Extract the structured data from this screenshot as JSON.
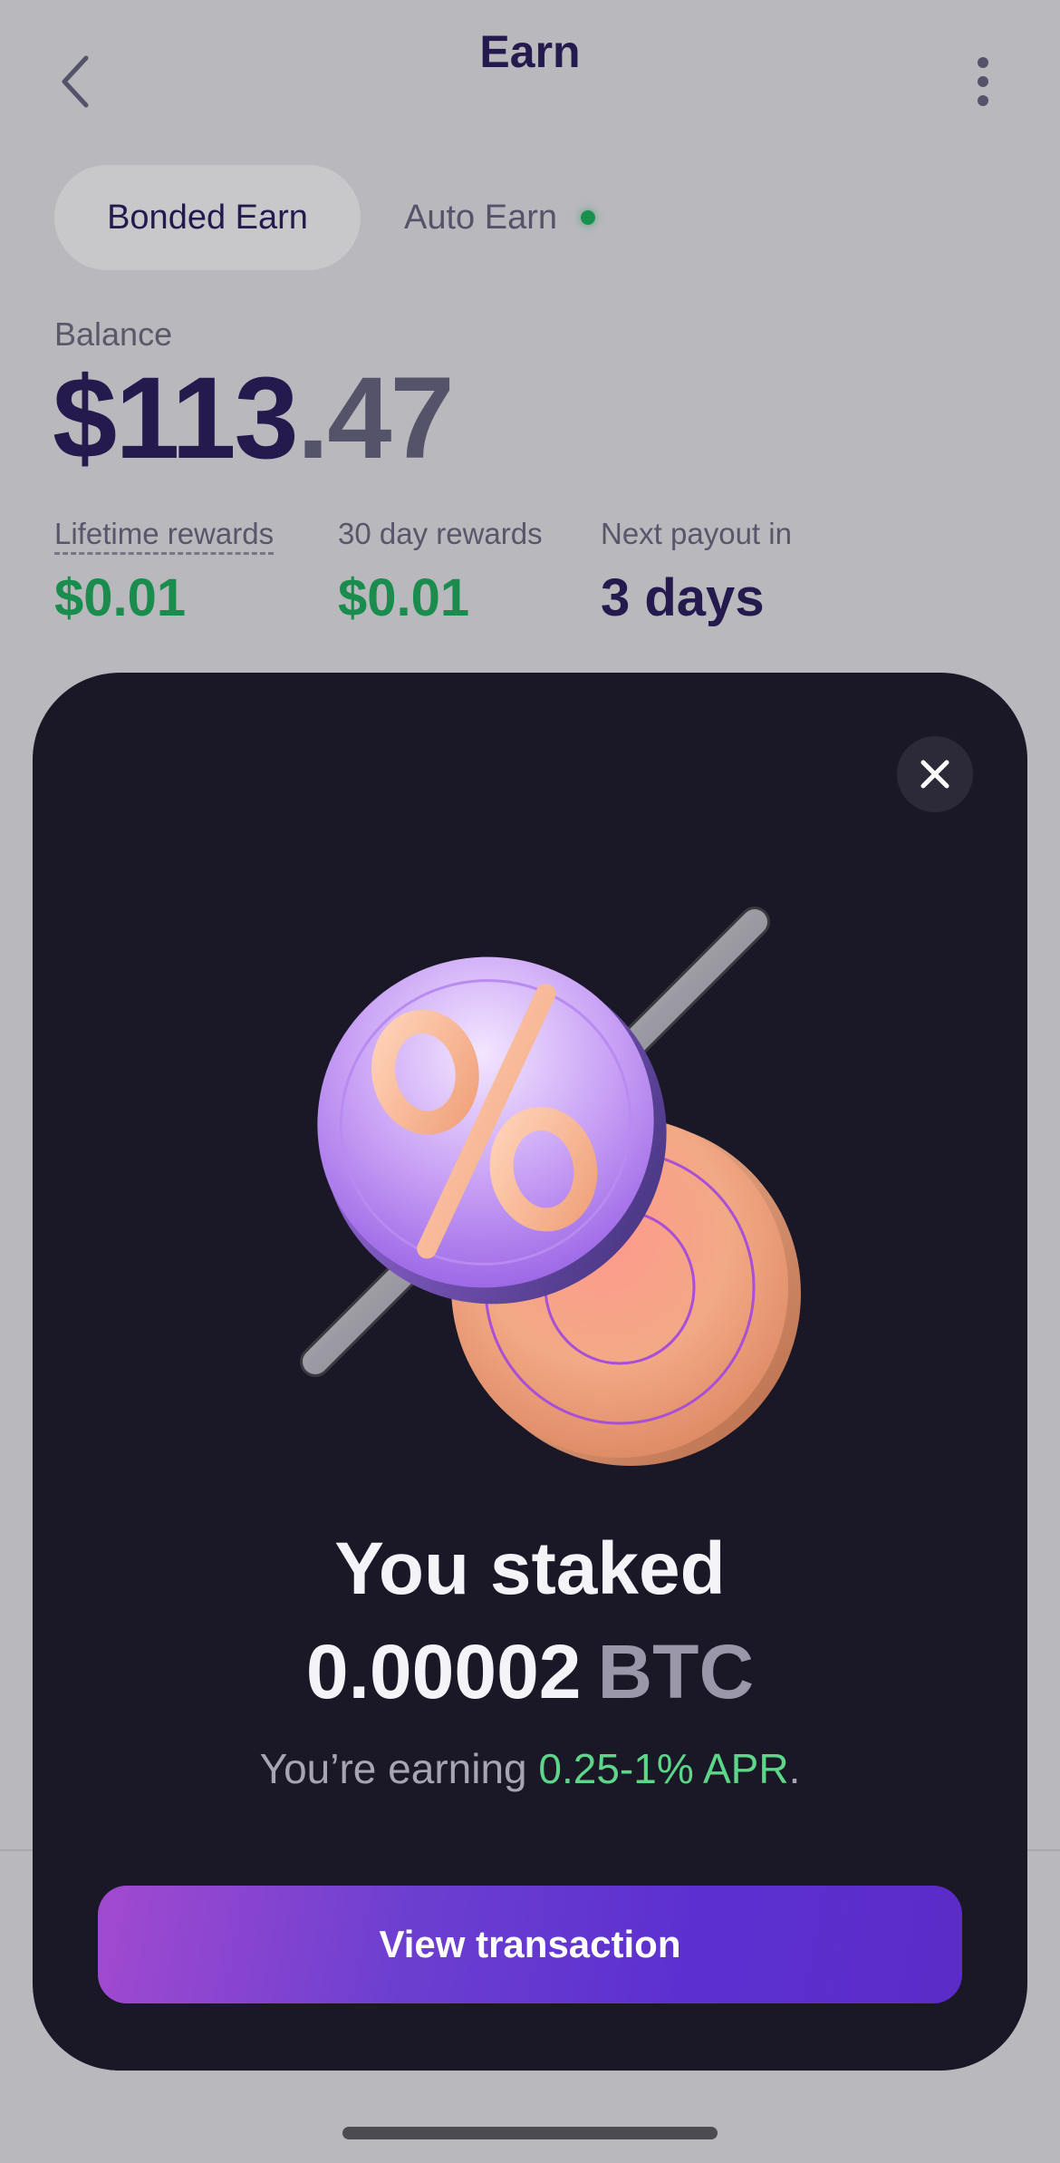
{
  "header": {
    "title": "Earn",
    "back_icon": "chevron-left-icon",
    "menu_icon": "more-vertical-icon"
  },
  "tabs": [
    {
      "label": "Bonded Earn",
      "active": true
    },
    {
      "label": "Auto Earn",
      "active": false,
      "status_dot": true
    }
  ],
  "balance": {
    "label": "Balance",
    "whole": "$113",
    "cents": ".47"
  },
  "stats": [
    {
      "label": "Lifetime rewards",
      "value": "$0.01"
    },
    {
      "label": "30 day rewards",
      "value": "$0.01"
    },
    {
      "label": "Next payout in",
      "value": "3 days"
    }
  ],
  "modal": {
    "close_icon": "close-icon",
    "illustration": "percent-coin-illustration",
    "headline": "You staked",
    "amount": "0.00002",
    "unit": "BTC",
    "earning_prefix": "You’re earning ",
    "apr": "0.25-1% APR",
    "earning_suffix": ".",
    "cta_label": "View transaction"
  },
  "colors": {
    "accent_green": "#198c4e",
    "apr_green": "#5ed68a",
    "navy": "#241a4d",
    "sheet_bg": "#1a1826",
    "cta_purple": "#5b2fd0"
  }
}
